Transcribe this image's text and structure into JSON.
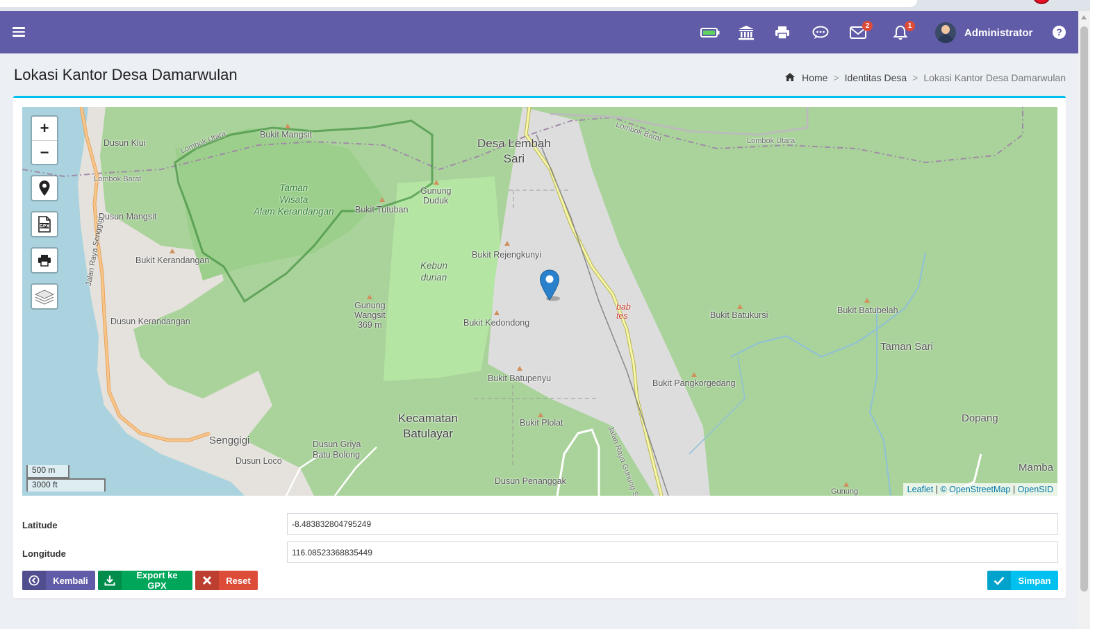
{
  "navbar": {
    "user_name": "Administrator",
    "mail_badge": "2",
    "notif_badge": "1",
    "brand_color": "#605ca8"
  },
  "page": {
    "title": "Lokasi Kantor Desa Damarwulan"
  },
  "breadcrumb": {
    "home": "Home",
    "parent": "Identitas Desa",
    "current": "Lokasi Kantor Desa Damarwulan",
    "separator": ">"
  },
  "map": {
    "zoom_in": "+",
    "zoom_out": "−",
    "scale_metric": "500 m",
    "scale_imperial": "3000 ft",
    "attribution": {
      "leaflet": "Leaflet",
      "sep1": "|",
      "osm": "© OpenStreetMap",
      "sep2": "|",
      "opensid": "OpenSID"
    },
    "labels": {
      "desa_lembah_sari": "Desa Lembah\nSari",
      "dusun_klui": "Dusun Klui",
      "lombok_barat_1": "Lombok Barat",
      "lombok_utara_1": "Lombok Utara",
      "bukit_mangsit": "Bukit Mangsit",
      "taman_wisata": "Taman\nWisata\nAlam Kerandangan",
      "gunung_duduk": "Gunung\nDuduk",
      "bukit_tutuban": "Bukit Tutuban",
      "dusun_mangsit": "Dusun Mangsit",
      "kebun_durian": "Kebun\ndurian",
      "bukit_kerandangan": "Bukit Kerandangan",
      "bukit_rejengkunyi": "Bukit Rejengkunyi",
      "jalan_raya_senggigi": "Jalan Raya Senggigi",
      "gunung_wangsit": "Gunung\nWangsit\n369 m",
      "bukit_kedondong": "Bukit Kedondong",
      "bab_tes": "bab\ntes",
      "bukit_batukursi": "Bukit Batukursi",
      "bukit_batubelah": "Bukit Batubelah",
      "taman_sari": "Taman Sari",
      "dusun_kerandangan": "Dusun Kerandangan",
      "bukit_batupenyu": "Bukit Batupenyu",
      "bukit_pangkorgedang": "Bukit Pangkorgedang",
      "kecamatan_batulayar": "Kecamatan\nBatulayar",
      "bukit_plolat": "Bukit Plolat",
      "dopang": "Dopang",
      "senggigi": "Senggigi",
      "dusun_griya": "Dusun Griya\nBatu Bolong",
      "dusun_loco": "Dusun Loco",
      "dusun_penanggak": "Dusun Penanggak",
      "jalan_raya_gunung_sari": "Jalan Raya Gunung Sari - Jalan Haji Ma",
      "mamba": "Mamba",
      "gunung_bottom": "Gunung",
      "lombok_barat_2": "Lombok Barat",
      "lombok_utara_2": "Lombok Utara"
    }
  },
  "form": {
    "latitude_label": "Latitude",
    "latitude_value": "-8.483832804795249",
    "longitude_label": "Longitude",
    "longitude_value": "116.08523368835449"
  },
  "buttons": {
    "back": "Kembali",
    "export_gpx": "Export ke GPX",
    "reset": "Reset",
    "save": "Simpan"
  }
}
